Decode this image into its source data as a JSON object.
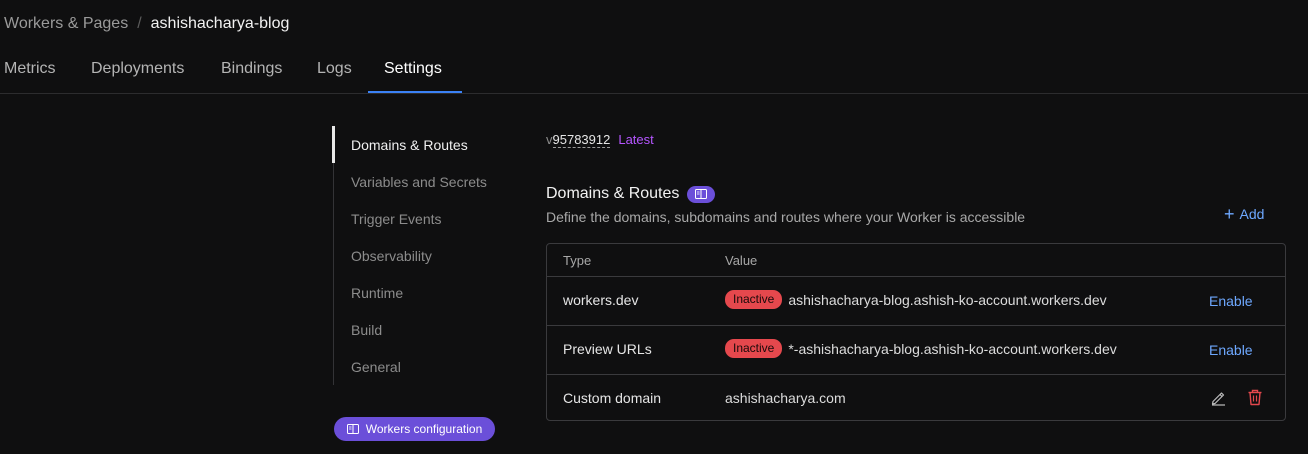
{
  "breadcrumb": {
    "parent": "Workers & Pages",
    "separator": "/",
    "current": "ashishacharya-blog"
  },
  "tabs": [
    {
      "label": "Metrics"
    },
    {
      "label": "Deployments"
    },
    {
      "label": "Bindings"
    },
    {
      "label": "Logs"
    },
    {
      "label": "Settings",
      "active": true
    }
  ],
  "sidenav": {
    "items": [
      {
        "label": "Domains & Routes",
        "active": true
      },
      {
        "label": "Variables and Secrets"
      },
      {
        "label": "Trigger Events"
      },
      {
        "label": "Observability"
      },
      {
        "label": "Runtime"
      },
      {
        "label": "Build"
      },
      {
        "label": "General"
      }
    ],
    "config_badge": "Workers configuration"
  },
  "version": {
    "prefix": "v",
    "id": "95783912",
    "tag": "Latest"
  },
  "section": {
    "title": "Domains & Routes",
    "description": "Define the domains, subdomains and routes where your Worker is accessible",
    "add_label": "Add"
  },
  "table": {
    "headers": {
      "type": "Type",
      "value": "Value"
    },
    "rows": [
      {
        "type": "workers.dev",
        "status": "Inactive",
        "value": "ashishacharya-blog.ashish-ko-account.workers.dev",
        "action": "Enable"
      },
      {
        "type": "Preview URLs",
        "status": "Inactive",
        "value": "*-ashishacharya-blog.ashish-ko-account.workers.dev",
        "action": "Enable"
      },
      {
        "type": "Custom domain",
        "value": "ashishacharya.com"
      }
    ]
  },
  "icons": {
    "doc": "book-icon",
    "add": "plus-icon",
    "edit": "pencil-icon",
    "delete": "trash-icon"
  },
  "colors": {
    "accent_blue": "#3b82f6",
    "link_blue": "#6ea8ff",
    "purple_badge": "#6b4fd9",
    "latest_purple": "#b556ff",
    "inactive_red": "#e5484d",
    "delete_red": "#e5484d"
  }
}
